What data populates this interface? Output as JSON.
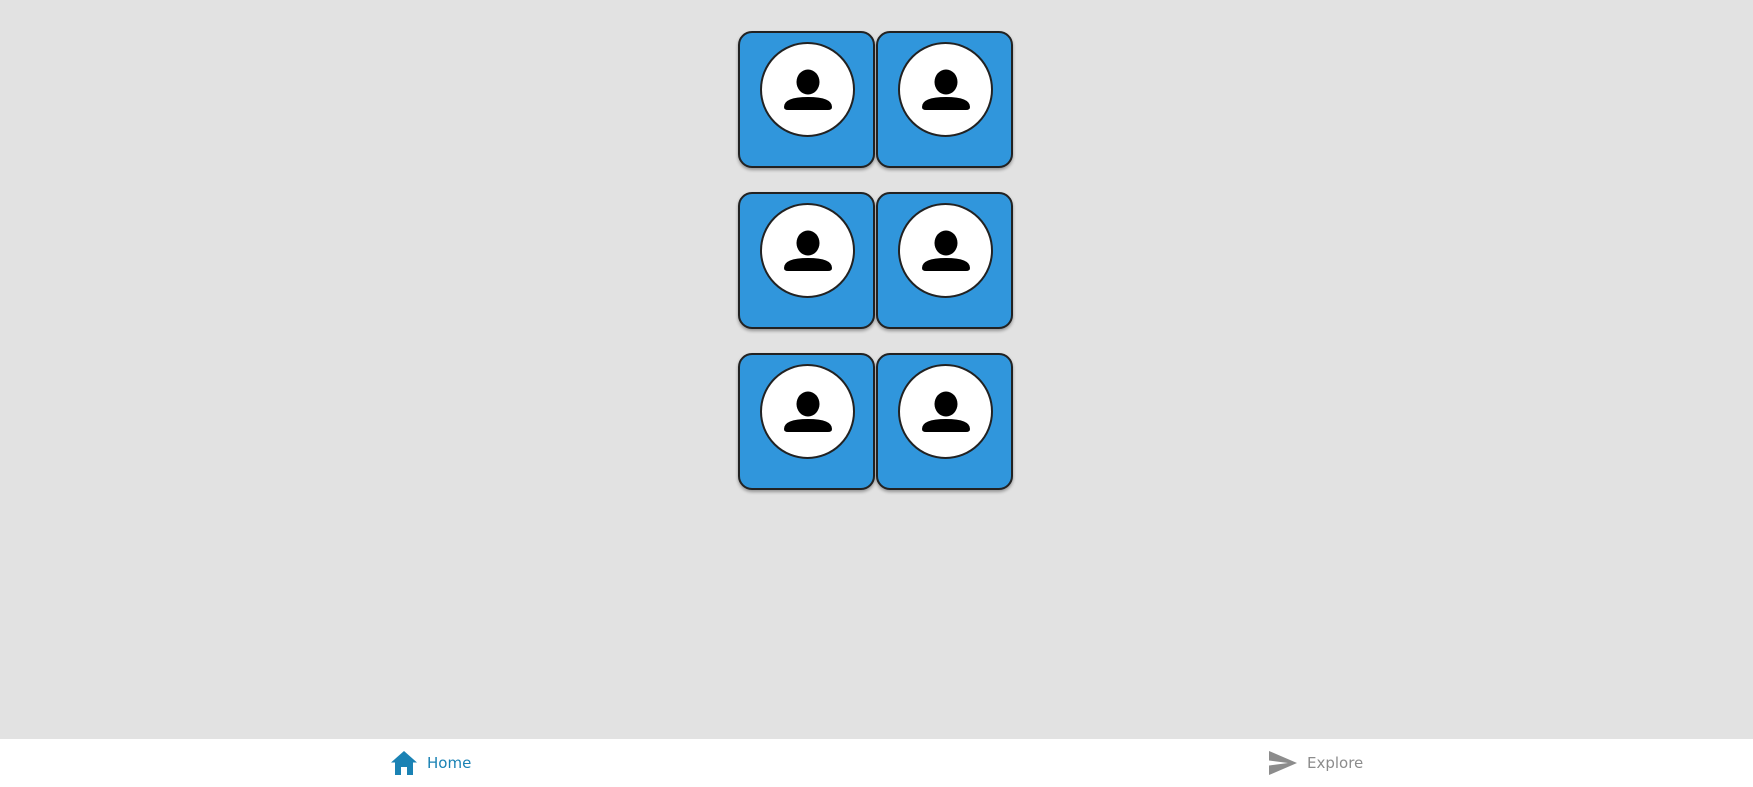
{
  "profiles": [
    {
      "icon": "person-icon"
    },
    {
      "icon": "person-icon"
    },
    {
      "icon": "person-icon"
    },
    {
      "icon": "person-icon"
    },
    {
      "icon": "person-icon"
    },
    {
      "icon": "person-icon"
    }
  ],
  "nav": {
    "home": {
      "label": "Home",
      "icon": "home-icon",
      "active": true
    },
    "explore": {
      "label": "Explore",
      "icon": "send-icon",
      "active": false
    }
  },
  "colors": {
    "background": "#e2e2e2",
    "tile": "#3096dc",
    "nav_active": "#1a82b4",
    "nav_inactive": "#8c8c8c",
    "nav_bar": "#ffffff"
  }
}
